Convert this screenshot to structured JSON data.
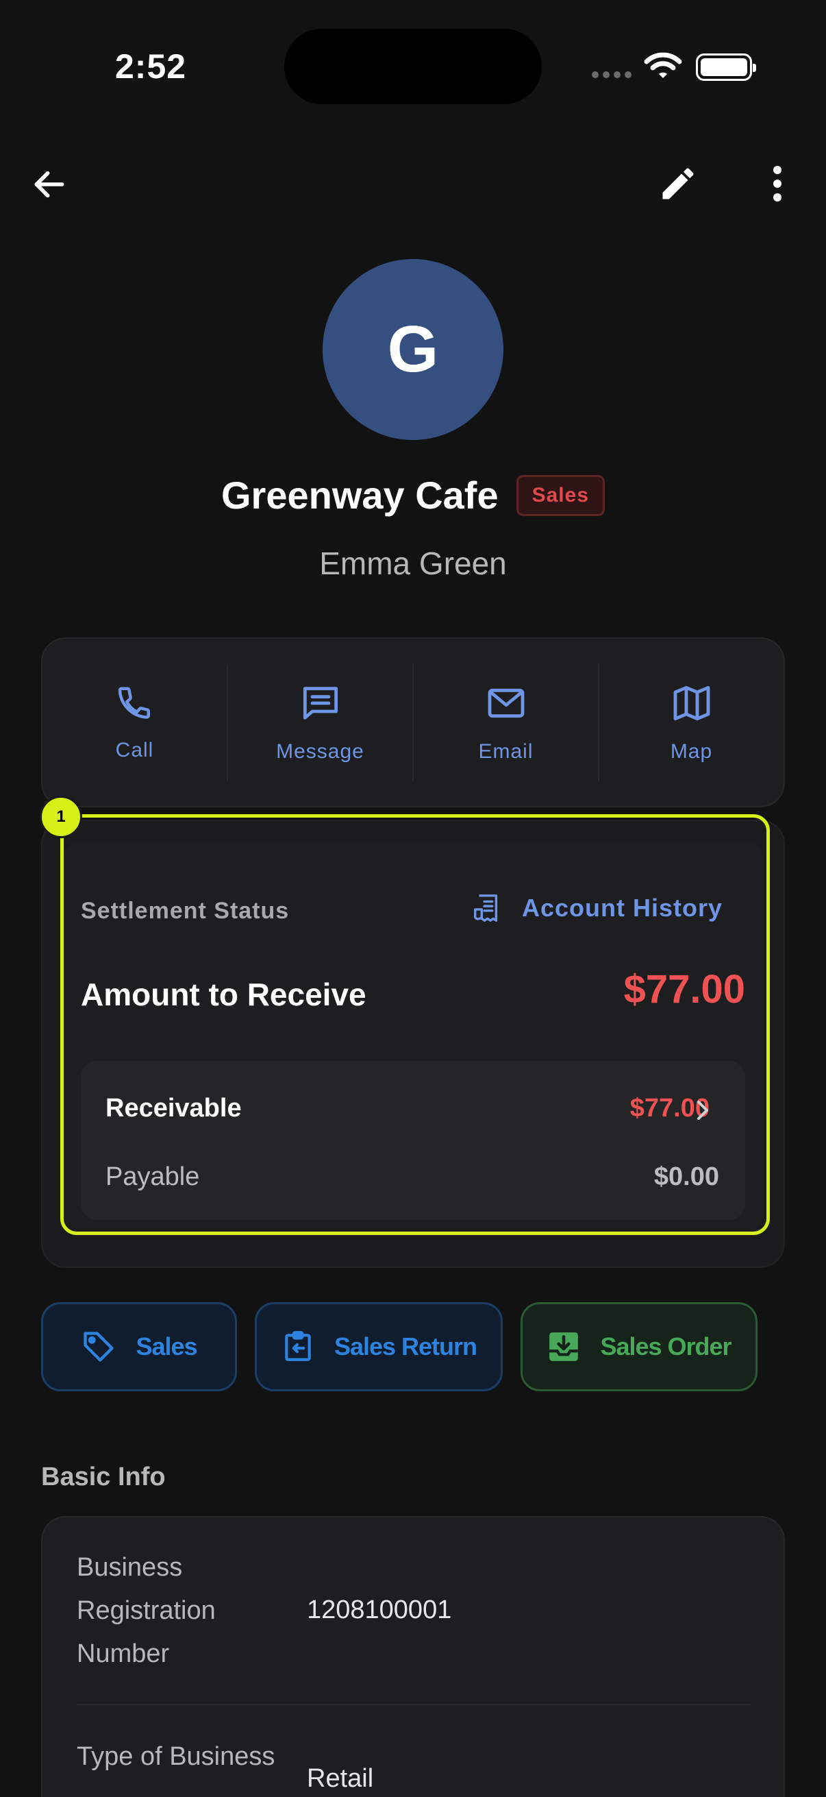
{
  "status_bar": {
    "time": "2:52"
  },
  "header": {
    "avatar_letter": "G",
    "business_name": "Greenway Cafe",
    "badge": "Sales",
    "contact_name": "Emma Green"
  },
  "actions": [
    {
      "label": "Call",
      "icon": "phone-icon"
    },
    {
      "label": "Message",
      "icon": "message-icon"
    },
    {
      "label": "Email",
      "icon": "mail-icon"
    },
    {
      "label": "Map",
      "icon": "map-icon"
    }
  ],
  "settlement": {
    "marker": "1",
    "status_label": "Settlement Status",
    "history_label": "Account History",
    "amount_label": "Amount to Receive",
    "amount_value": "$77.00",
    "receivable_label": "Receivable",
    "receivable_value": "$77.00",
    "payable_label": "Payable",
    "payable_value": "$0.00"
  },
  "quick_actions": [
    {
      "label": "Sales",
      "icon": "tag-icon"
    },
    {
      "label": "Sales Return",
      "icon": "clipboard-return-icon"
    },
    {
      "label": "Sales Order",
      "icon": "inbox-download-icon"
    }
  ],
  "basic_info": {
    "title": "Basic Info",
    "rows": [
      {
        "label": "Business Registration Number",
        "value": "1208100001"
      },
      {
        "label": "Type of Business",
        "value": "Retail"
      }
    ]
  },
  "colors": {
    "accent_blue": "#6e95e6",
    "alert_red": "#ef5252",
    "highlight": "#d6f116",
    "success_green": "#47a957"
  }
}
